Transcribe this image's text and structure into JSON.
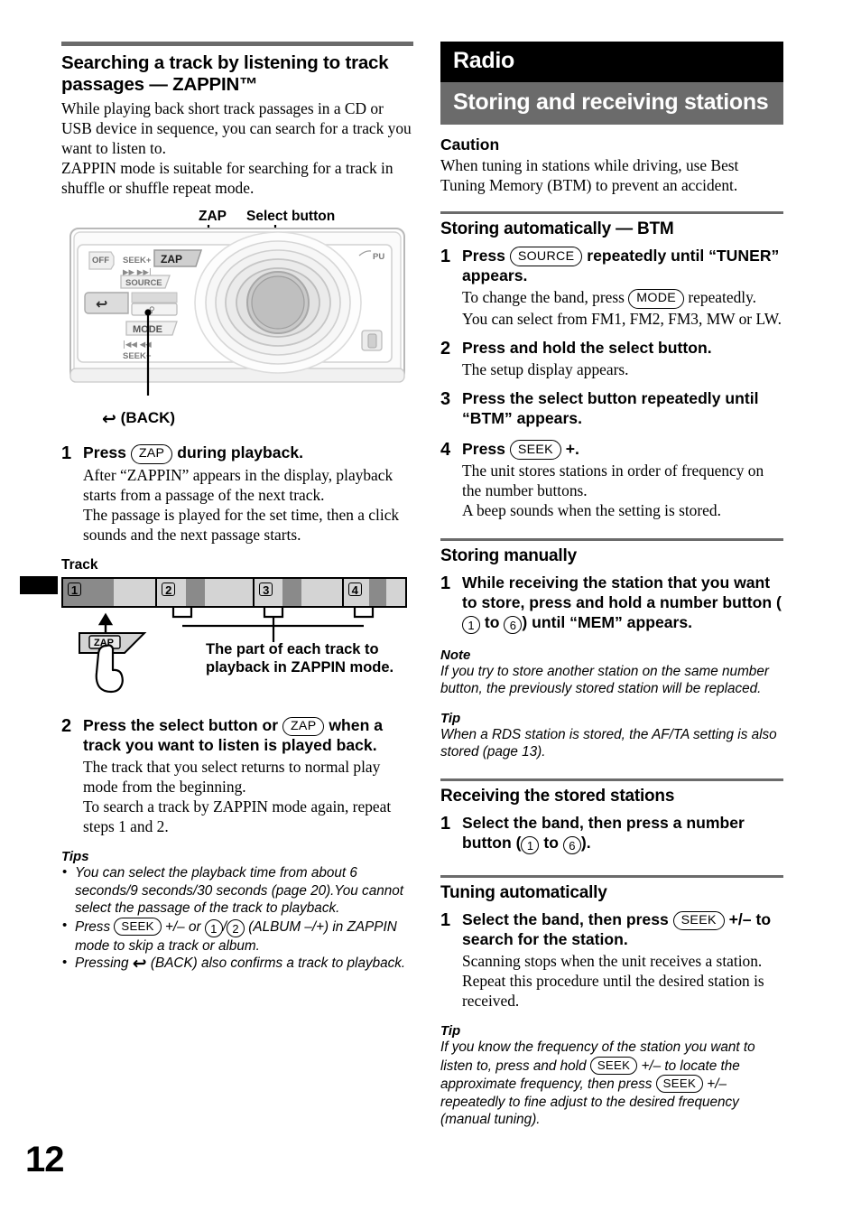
{
  "page": {
    "number": "12"
  },
  "left_column": {
    "heading": "Searching a track by listening to track passages — ZAPPIN™",
    "intro_1": "While playing back short track passages in a CD or USB device in sequence, you can search for a track you want to listen to.",
    "intro_2": "ZAPPIN mode is suitable for searching for a track in shuffle or shuffle repeat mode.",
    "device_figure": {
      "label_zap": "ZAP",
      "label_select": "Select button",
      "caption_back": "(BACK)",
      "faceplate_keys": {
        "off": "OFF",
        "seek_plus": "SEEK+",
        "zap": "ZAP",
        "source": "SOURCE",
        "mode": "MODE",
        "seek_minus": "SEEK−",
        "pull": "PU"
      }
    },
    "step1": {
      "number": "1",
      "head_before": "Press",
      "head_key": "ZAP",
      "head_after": "during playback.",
      "text_1": "After “ZAPPIN” appears in the display, playback starts from a passage of the next track.",
      "text_2": "The passage is played for the set time, then a click sounds and the next passage starts."
    },
    "track_figure": {
      "title": "Track",
      "tracks": [
        "1",
        "2",
        "3",
        "4"
      ],
      "zap_button": "ZAP",
      "caption": "The part of each track to playback in ZAPPIN mode."
    },
    "step2": {
      "number": "2",
      "head_before": "Press the select button or",
      "head_key": "ZAP",
      "head_after": "when a track you want to listen is played back.",
      "text_1": "The track that you select returns to normal play mode from the beginning.",
      "text_2": "To search a track by ZAPPIN mode again, repeat steps 1 and 2."
    },
    "tips": {
      "title": "Tips",
      "items": [
        {
          "segments": [
            {
              "type": "text",
              "value": "You can select the playback time from about 6 seconds/9 seconds/30 seconds (page 20).You cannot select the passage of the track to playback."
            }
          ]
        },
        {
          "segments": [
            {
              "type": "text",
              "value": "Press "
            },
            {
              "type": "key",
              "value": "SEEK"
            },
            {
              "type": "text",
              "value": " +/– or "
            },
            {
              "type": "keynum",
              "value": "1"
            },
            {
              "type": "text",
              "value": "/"
            },
            {
              "type": "keynum",
              "value": "2"
            },
            {
              "type": "text",
              "value": " (ALBUM –/+) in ZAPPIN mode to skip a track or album."
            }
          ]
        },
        {
          "segments": [
            {
              "type": "text",
              "value": "Pressing "
            },
            {
              "type": "glyph",
              "value": "back-arrow"
            },
            {
              "type": "text",
              "value": " (BACK) also confirms a track to playback."
            }
          ]
        }
      ]
    }
  },
  "right_column": {
    "banner_primary": "Radio",
    "banner_secondary": "Storing and receiving stations",
    "caution": {
      "title": "Caution",
      "text": "When tuning in stations while driving, use Best Tuning Memory (BTM) to prevent an accident."
    },
    "btm": {
      "heading": "Storing automatically — BTM",
      "steps": [
        {
          "number": "1",
          "head_before": "Press",
          "head_key": "SOURCE",
          "head_after": "repeatedly until “TUNER” appears.",
          "text_before": "To change the band, press",
          "text_key": "MODE",
          "text_after": "repeatedly. You can select from FM1, FM2, FM3, MW or LW."
        },
        {
          "number": "2",
          "head": "Press and hold the select button.",
          "text": "The setup display appears."
        },
        {
          "number": "3",
          "head": "Press the select button repeatedly until “BTM” appears."
        },
        {
          "number": "4",
          "head_before": "Press",
          "head_key": "SEEK",
          "head_after": "+.",
          "text_1": "The unit stores stations in order of frequency on the number buttons.",
          "text_2": "A beep sounds when the setting is stored."
        }
      ]
    },
    "storing_manually": {
      "heading": "Storing manually",
      "step": {
        "number": "1",
        "head_1": "While receiving the station that you want to store, press and hold a number button (",
        "key_from": "1",
        "head_mid": "to",
        "key_to": "6",
        "head_2": ") until “MEM” appears."
      },
      "note": {
        "title": "Note",
        "text": "If you try to store another station on the same number button, the previously stored station will be replaced."
      },
      "tip": {
        "title": "Tip",
        "text": "When a RDS station is stored, the AF/TA setting is also stored (page 13)."
      }
    },
    "receiving": {
      "heading": "Receiving the stored stations",
      "step": {
        "number": "1",
        "head_1": "Select the band, then press a number button (",
        "key_from": "1",
        "head_mid": "to",
        "key_to": "6",
        "head_2": ")."
      }
    },
    "tuning": {
      "heading": "Tuning automatically",
      "step": {
        "number": "1",
        "head_before": "Select the band, then press",
        "head_key": "SEEK",
        "head_after": "+/– to search for the station.",
        "text": "Scanning stops when the unit receives a station. Repeat this procedure until the desired station is received."
      },
      "tip": {
        "title": "Tip",
        "part_1": "If you know the frequency of the station you want to listen to, press and hold",
        "key_1": "SEEK",
        "part_2": "+/– to locate the approximate frequency, then press",
        "key_2": "SEEK",
        "part_3": "+/– repeatedly to fine adjust to the desired frequency (manual tuning)."
      }
    }
  },
  "colors": {
    "banner_primary_bg": "#000000",
    "banner_secondary_bg": "#6b6b6b",
    "rule": "#6b6b6b",
    "track_light": "#d4d4d4",
    "track_dark": "#8a8a8a"
  }
}
